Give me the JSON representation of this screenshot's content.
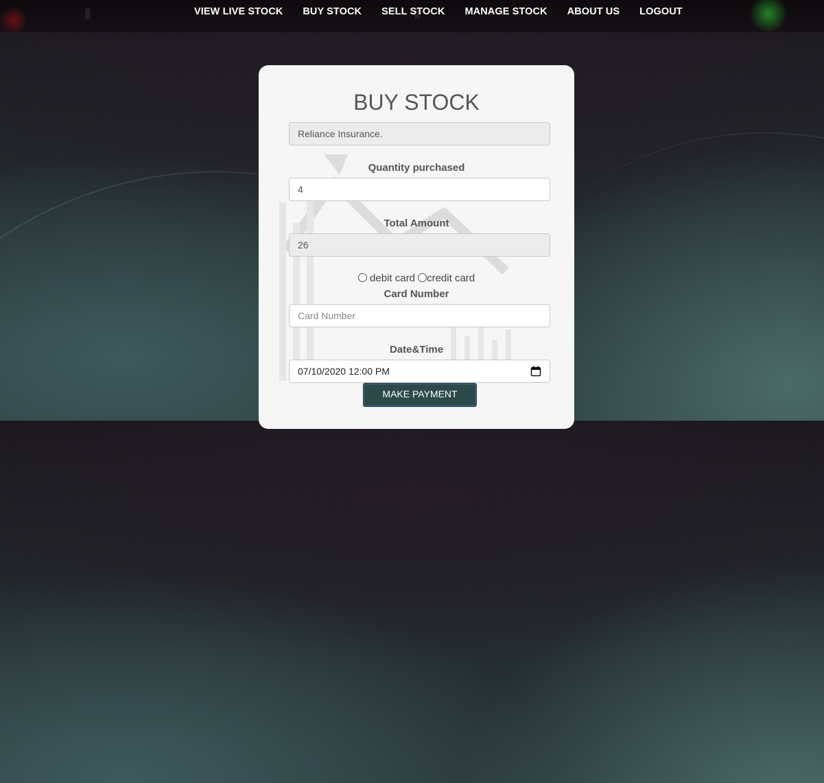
{
  "nav": {
    "items": [
      {
        "label": "VIEW LIVE STOCK"
      },
      {
        "label": "BUY STOCK"
      },
      {
        "label": "SELL STOCK"
      },
      {
        "label": "MANAGE STOCK"
      },
      {
        "label": "ABOUT US"
      },
      {
        "label": "LOGOUT"
      }
    ]
  },
  "form": {
    "title": "BUY STOCK",
    "company_value": "Reliance Insurance.",
    "quantity_label": "Quantity purchased",
    "quantity_value": "4",
    "total_label": "Total Amount",
    "total_value": "26",
    "payment_options": {
      "debit_label": "debit card",
      "credit_label": "credit card"
    },
    "card_number_label": "Card Number",
    "card_number_placeholder": "Card Number",
    "datetime_label": "Date&Time",
    "datetime_value": "07/10/2020 12:00 PM",
    "submit_label": "MAKE PAYMENT"
  },
  "colors": {
    "submit_button": "#2d4a4b",
    "card_background": "#f6f6f6",
    "nav_text": "#ffffff"
  }
}
